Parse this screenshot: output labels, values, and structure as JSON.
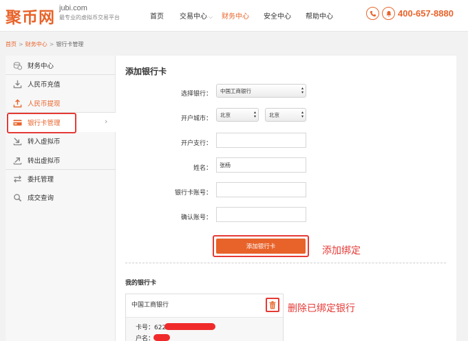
{
  "header": {
    "logo_text": "聚币网",
    "logo_domain": "jubi.com",
    "logo_slogan": "最专业的虚拟币交易平台",
    "nav": [
      {
        "label": "首页"
      },
      {
        "label": "交易中心"
      },
      {
        "label": "财务中心"
      },
      {
        "label": "安全中心"
      },
      {
        "label": "帮助中心"
      }
    ],
    "active_nav": "财务中心",
    "phone_icon": "phone-icon",
    "bell_icon": "bell-icon",
    "phone": "400-657-8880"
  },
  "breadcrumb": {
    "items": [
      "首页",
      "财务中心",
      "银行卡管理"
    ],
    "separator": ">"
  },
  "sidebar": {
    "items": [
      {
        "label": "财务中心",
        "icon": "coins-icon"
      },
      {
        "label": "人民币充值",
        "icon": "download-icon"
      },
      {
        "label": "人民币提现",
        "icon": "upload-icon"
      },
      {
        "label": "银行卡管理",
        "icon": "bank-card-icon"
      },
      {
        "label": "转入虚拟币",
        "icon": "transfer-in-icon"
      },
      {
        "label": "转出虚拟币",
        "icon": "transfer-out-icon"
      },
      {
        "label": "委托管理",
        "icon": "swap-arrows-icon"
      },
      {
        "label": "成交查询",
        "icon": "search-icon"
      }
    ],
    "selected": "银行卡管理",
    "chevron": "›"
  },
  "form": {
    "title": "添加银行卡",
    "bank_label": "选择银行：",
    "bank_value": "中国工商银行",
    "city_label": "开户城市：",
    "province_value": "北京",
    "city_value": "北京",
    "branch_label": "开户支行：",
    "branch_value": "",
    "name_label": "姓名：",
    "name_value": "张杨",
    "account_label": "银行卡账号：",
    "account_value": "",
    "confirm_label": "确认账号：",
    "confirm_value": "",
    "submit_label": "添加银行卡"
  },
  "annotations": {
    "add": "添加绑定",
    "delete": "删除已绑定银行"
  },
  "my_cards": {
    "title": "我的银行卡",
    "cards": [
      {
        "bank": "中国工商银行",
        "card_no_label": "卡号：",
        "card_no_visible": "6222",
        "owner_label": "户名：",
        "delete_icon": "trash-icon"
      }
    ]
  },
  "colors": {
    "brand": "#e8632a",
    "annotation": "#e53935"
  }
}
